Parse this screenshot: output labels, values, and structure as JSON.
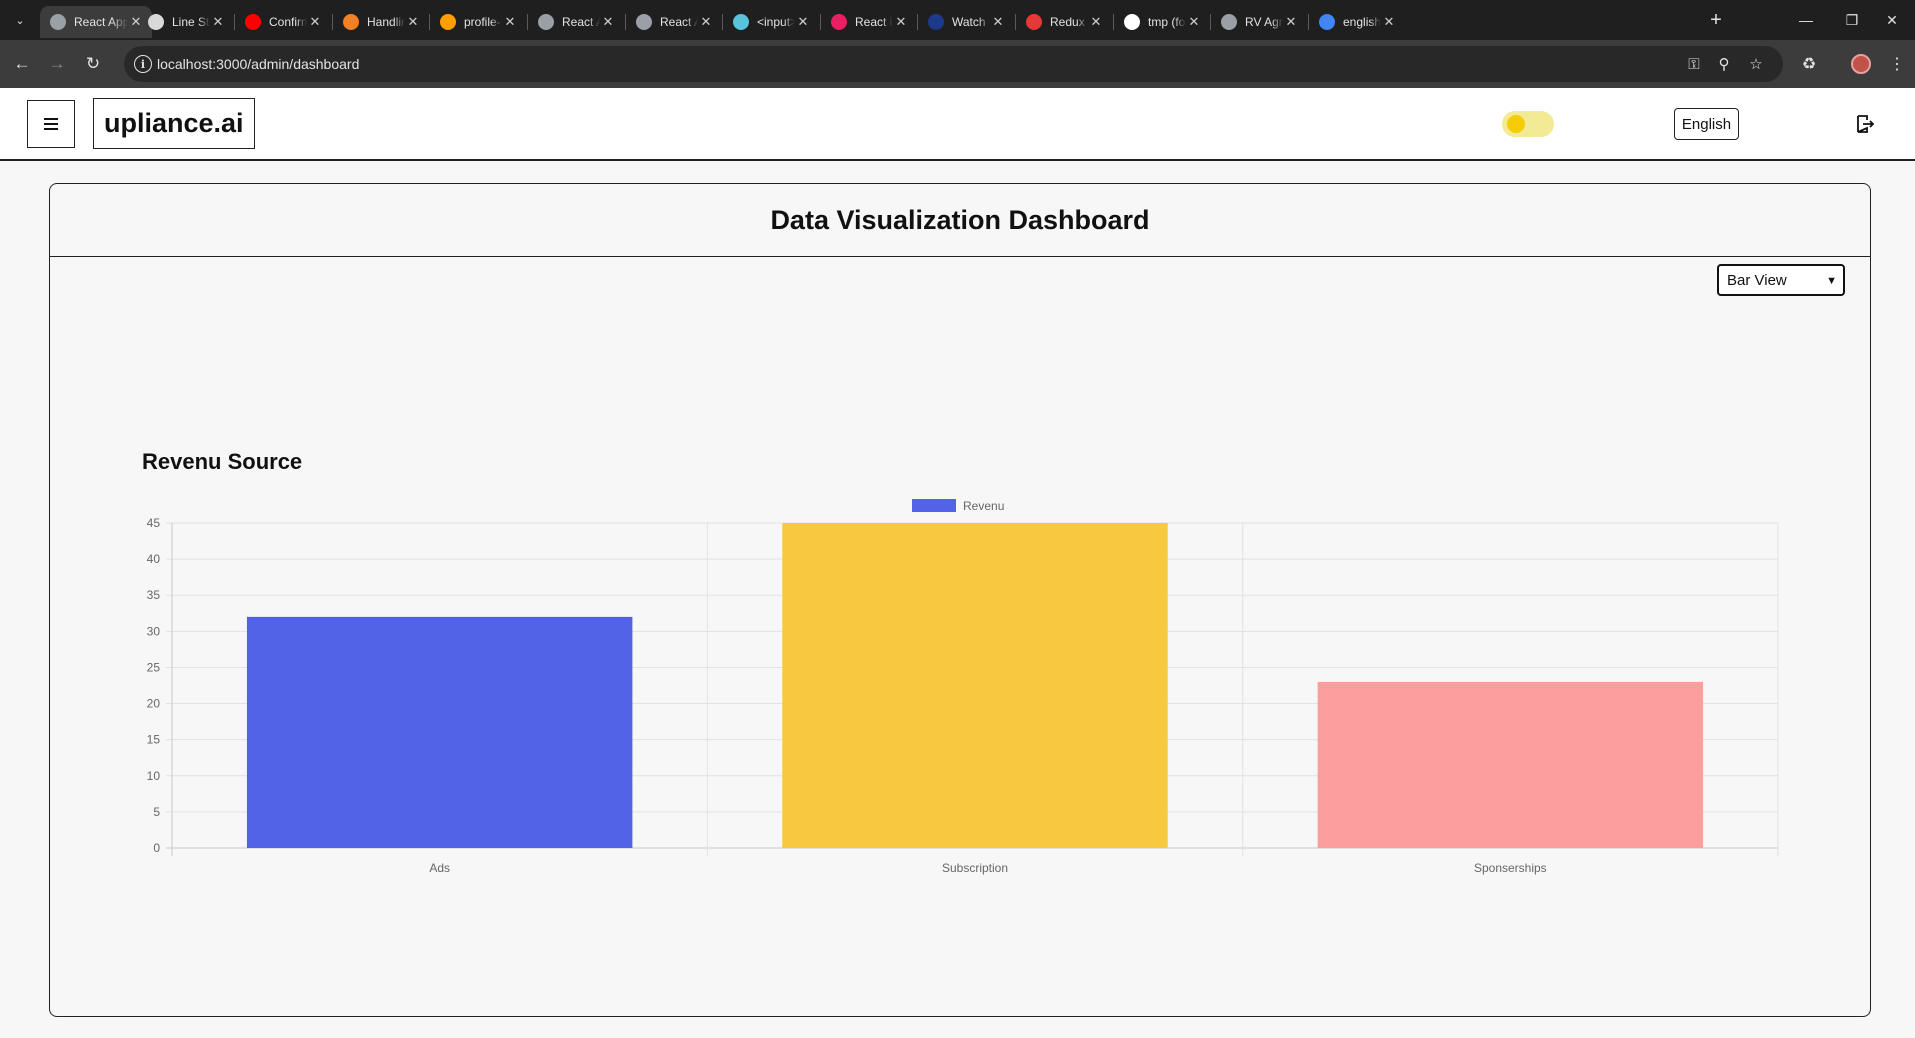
{
  "browser": {
    "tabs": [
      {
        "title": "React App",
        "favicon_color": "#9aa0a6",
        "active": true
      },
      {
        "title": "Line Styling",
        "favicon_color": "#d9d9d9"
      },
      {
        "title": "Confirm",
        "favicon_color": "#ff0000"
      },
      {
        "title": "Handling",
        "favicon_color": "#f48024"
      },
      {
        "title": "profile-m",
        "favicon_color": "#ffa000"
      },
      {
        "title": "React App",
        "favicon_color": "#9aa0a6"
      },
      {
        "title": "React App",
        "favicon_color": "#9aa0a6"
      },
      {
        "title": "<input>",
        "favicon_color": "#58c4dc"
      },
      {
        "title": "React icons",
        "favicon_color": "#e91e63"
      },
      {
        "title": "Watch S",
        "favicon_color": "#1d3a8a"
      },
      {
        "title": "Redux D",
        "favicon_color": "#e53935"
      },
      {
        "title": "tmp (fork",
        "favicon_color": "#ffffff"
      },
      {
        "title": "RV Agra",
        "favicon_color": "#9aa0a6"
      },
      {
        "title": "english t",
        "favicon_color": "#4285f4"
      }
    ],
    "url": "localhost:3000/admin/dashboard"
  },
  "header": {
    "brand": "upliance.ai",
    "language": "English",
    "theme_toggle_on": true
  },
  "dashboard": {
    "title": "Data Visualization Dashboard",
    "view_select": {
      "selected": "Bar View"
    },
    "chart_heading": "Revenu Source"
  },
  "chart_data": {
    "type": "bar",
    "categories": [
      "Ads",
      "Subscription",
      "Sponserships"
    ],
    "series": [
      {
        "name": "Revenu",
        "values": [
          32,
          45,
          23
        ]
      }
    ],
    "bar_colors": [
      "#5363e8",
      "#f8c93f",
      "#fc9d9e"
    ],
    "legend_color": "#5363e8",
    "ylim": [
      0,
      45
    ],
    "yticks": [
      0,
      5,
      10,
      15,
      20,
      25,
      30,
      35,
      40,
      45
    ],
    "legend_position": "top-center",
    "grid": true
  }
}
